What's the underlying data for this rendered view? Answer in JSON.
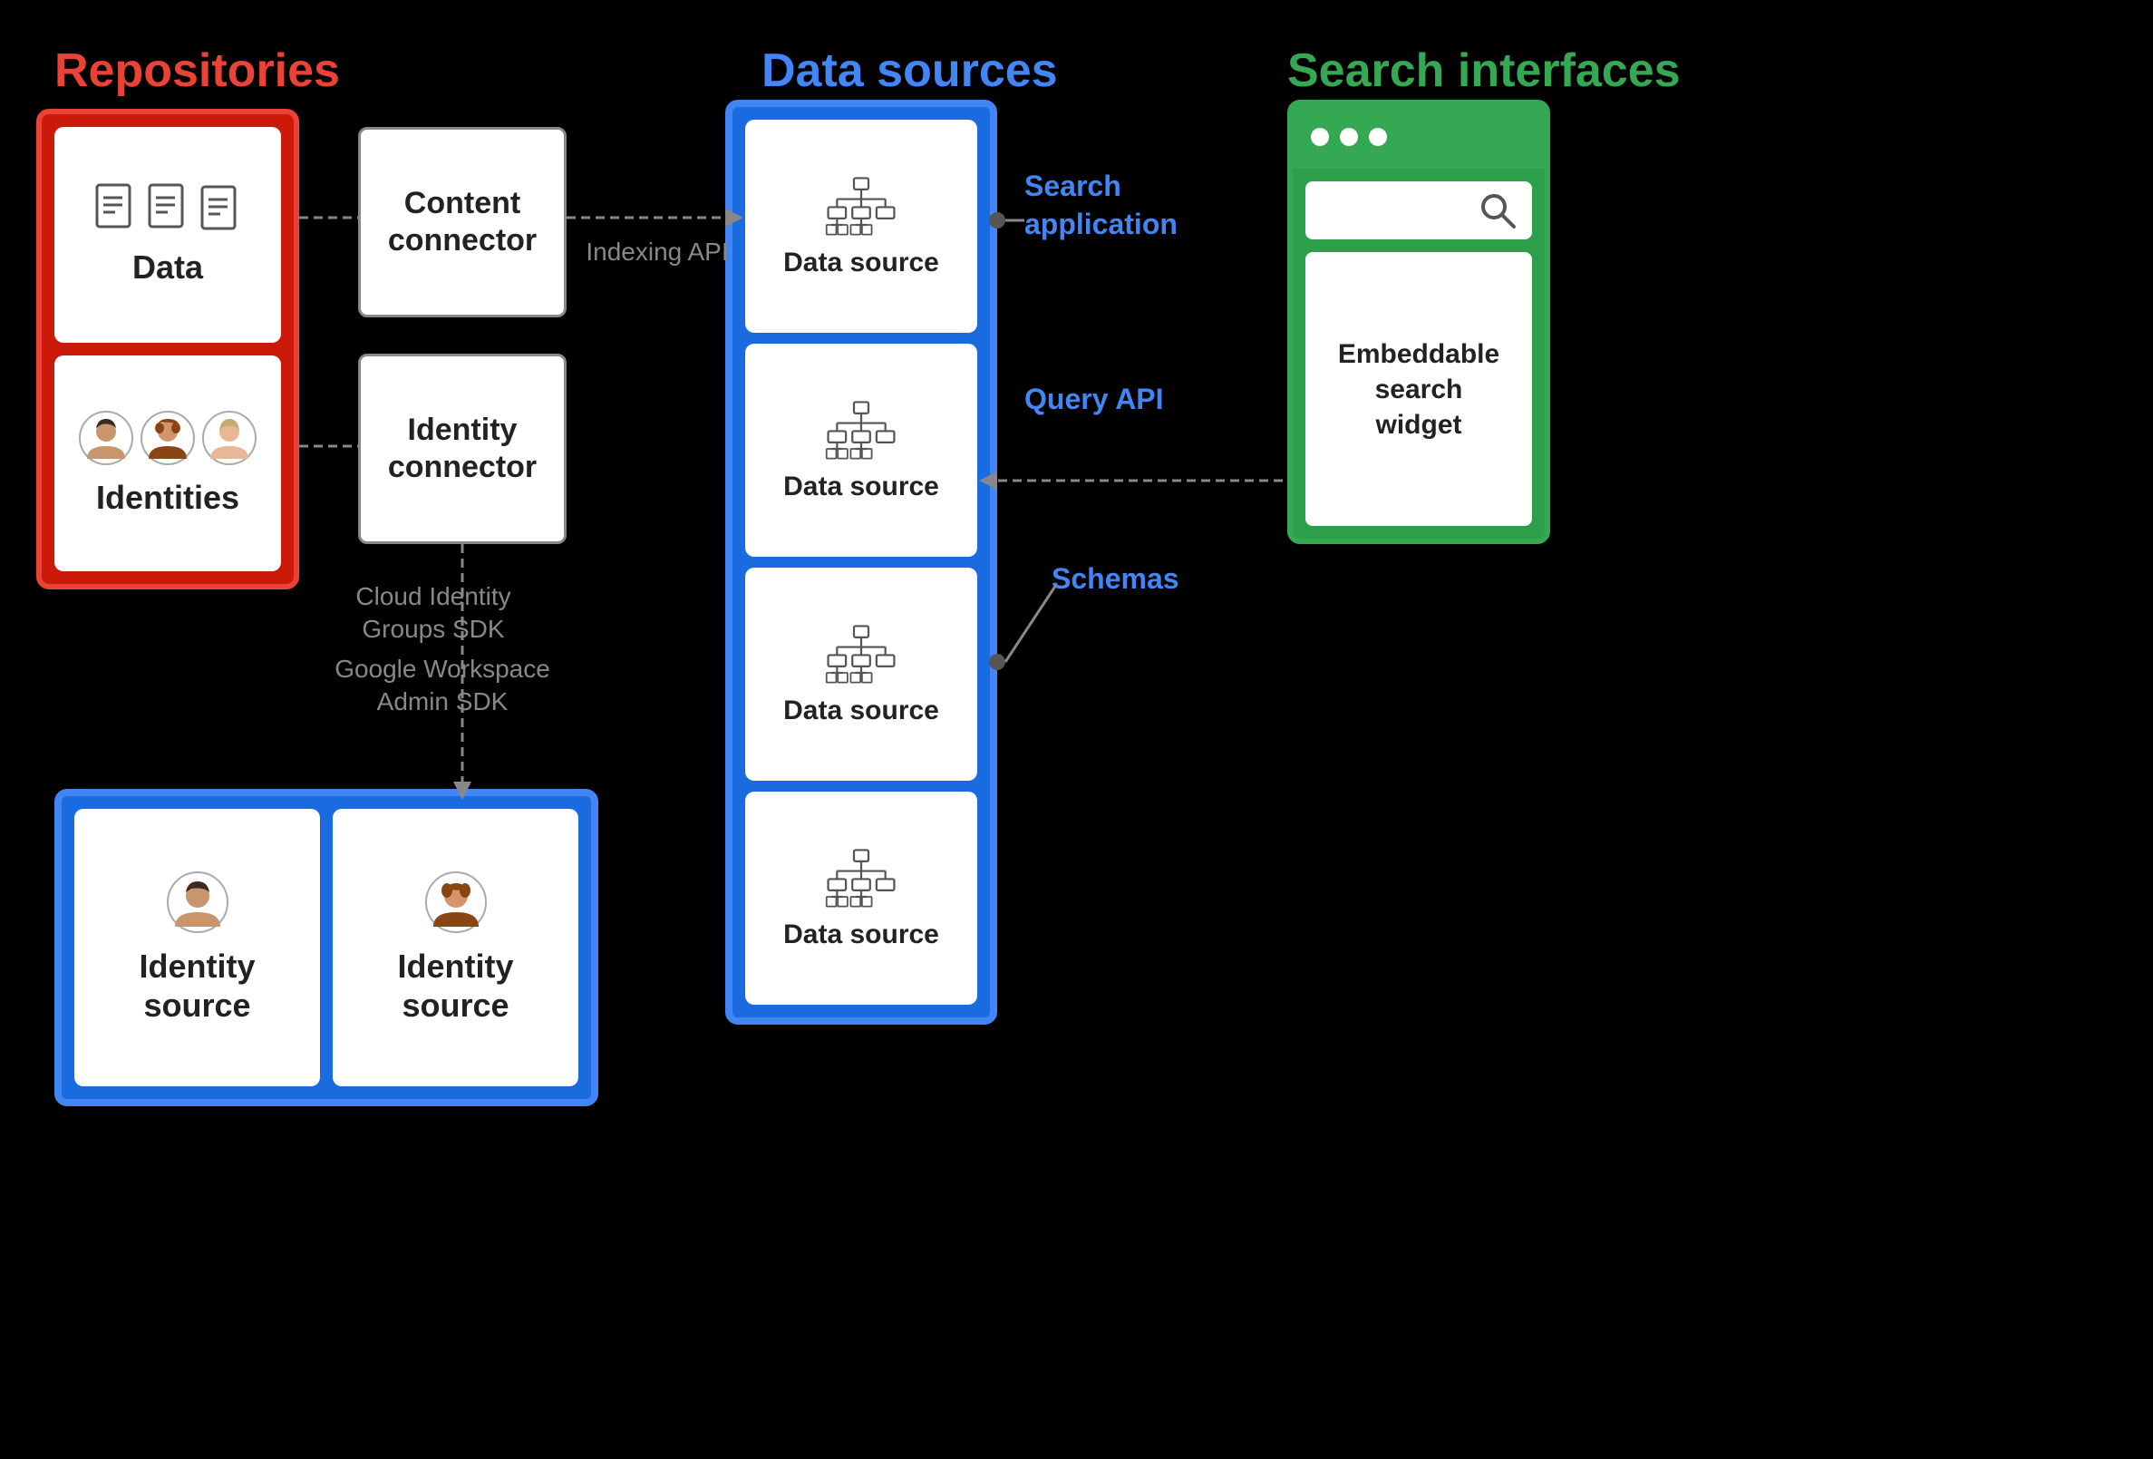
{
  "titles": {
    "repositories": "Repositories",
    "data_sources": "Data sources",
    "search_interfaces": "Search interfaces"
  },
  "repositories": {
    "data_label": "Data",
    "identities_label": "Identities"
  },
  "connectors": {
    "content_connector": "Content\nconnector",
    "identity_connector": "Identity\nconnector"
  },
  "data_sources": {
    "items": [
      {
        "label": "Data source"
      },
      {
        "label": "Data source"
      },
      {
        "label": "Data source"
      },
      {
        "label": "Data source"
      }
    ]
  },
  "search_interfaces": {
    "search_label": "Search",
    "widget_label": "Embeddable\nsearch\nwidget"
  },
  "identity_sources": {
    "items": [
      {
        "label": "Identity\nsource"
      },
      {
        "label": "Identity\nsource"
      }
    ]
  },
  "annotations": {
    "indexing_api": "Indexing API",
    "search_application": "Search\napplication",
    "query_api": "Query\nAPI",
    "schemas": "Schemas",
    "cloud_identity": "Cloud Identity\nGroups SDK",
    "google_workspace": "Google Workspace\nAdmin SDK"
  }
}
